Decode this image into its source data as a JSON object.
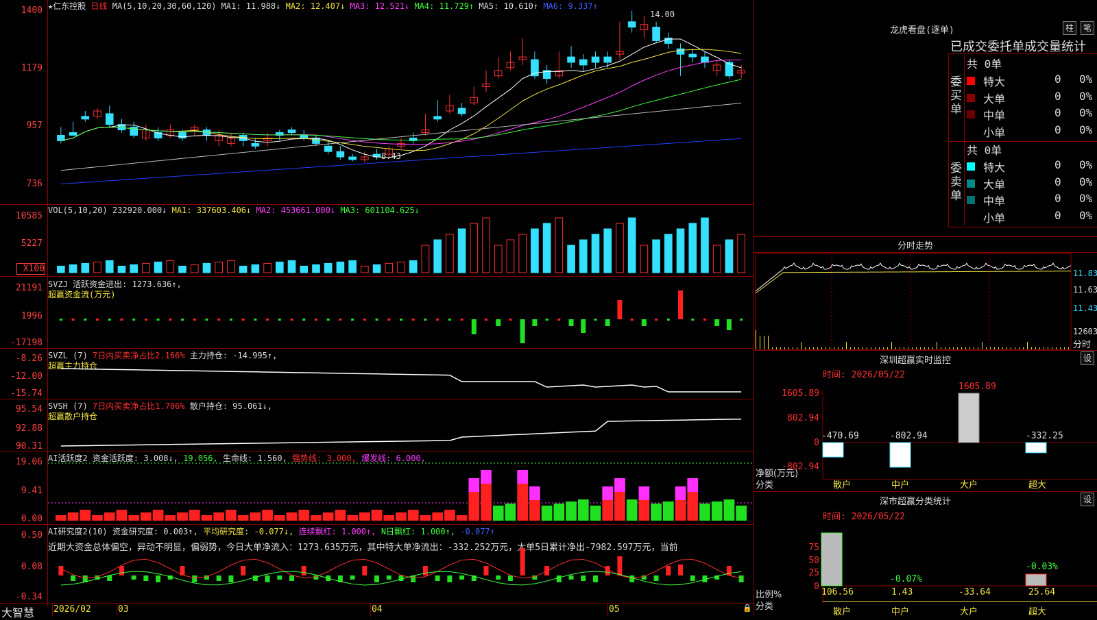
{
  "header": {
    "stock_name": "★仁东控股",
    "period": "日线",
    "ma_params": "MA(5,10,20,30,60,120)",
    "ma1": "MA1: 11.988↓",
    "ma2": "MA2: 12.407↓",
    "ma3": "MA3: 12.521↓",
    "ma4": "MA4: 11.729↑",
    "ma5": "MA5: 10.610↑",
    "ma6": "MA6: 9.337↑"
  },
  "price_axis": [
    "1400",
    "1179",
    "957",
    "736"
  ],
  "price_marks": {
    "high": "14.00",
    "low": "8.43"
  },
  "vol": {
    "params": "VOL(5,10,20)",
    "v": "232920.000↓",
    "ma1": "MA1: 337603.406↓",
    "ma2": "MA2: 453661.000↓",
    "ma3": "MA3: 601104.625↓",
    "axis": [
      "10585",
      "5227",
      "X100"
    ]
  },
  "svzj": {
    "name": "SVZJ",
    "line1": "活跃资金进出: 1273.636↑,",
    "line2": "超赢资金流(万元)",
    "axis": [
      "21191",
      "1996",
      "-17198"
    ]
  },
  "svzl": {
    "name": "SVZL (7)",
    "ratio": "7日内买卖净占比2.166%",
    "hold": "主力持仓: -14.995↑,",
    "line2": "超赢主力持仓",
    "axis": [
      "-8.26",
      "-12.00",
      "-15.74"
    ]
  },
  "svsh": {
    "name": "SVSH (7)",
    "ratio": "7日内买卖净占比1.706%",
    "hold": "散户持仓: 95.061↓,",
    "line2": "超赢散户持仓",
    "axis": [
      "95.54",
      "92.88",
      "90.31"
    ]
  },
  "ai1": {
    "name": "AI活跃度2",
    "a": "资金活跃度: 3.008↓,",
    "b": "19.056,",
    "c": "生命线: 1.560,",
    "d": "强势线: 3.000,",
    "e": "爆发线: 6.000,",
    "axis": [
      "19.06",
      "9.41",
      "0.00"
    ]
  },
  "ai2": {
    "name": "AI研究度2(10)",
    "a": "资金研究度: 0.003↑,",
    "b": "平均研究度: -0.077↓,",
    "c": "连续飘红: 1.000↑,",
    "d": "N日飘红: 1.000↑,",
    "e": "-0.077↑",
    "comment": "近期大资金总体偏空，异动不明显，偏弱势，今日大单净流入：1273.635万元，其中特大单净流出：-332.252万元，大单5日累计净出-7982.597万元，当前",
    "axis": [
      "0.50",
      "0.08",
      "-0.34"
    ]
  },
  "bottom": {
    "logo": "大智慧",
    "dates": [
      "2026/02",
      "03",
      "04",
      "05"
    ]
  },
  "right": {
    "lhb_title": "龙虎看盘(逐单)",
    "btn_zhu": "柱",
    "btn_bi": "笔",
    "tabs": "已成交委托单成交量统计",
    "buy_label": "委买单",
    "sell_label": "委卖单",
    "buy_total": "共 0单",
    "sell_total": "共 0单",
    "rows": [
      "特大",
      "大单",
      "中单",
      "小单"
    ],
    "zero": "0",
    "pct": "0%",
    "fs_title": "分时走势",
    "fs_axis": [
      "11.83",
      "11.63",
      "11.43",
      "12603"
    ],
    "fs_unit": "分时",
    "monitor_title": "深圳超赢实时监控",
    "monitor_time": "时间: 2026/05/22",
    "monitor_btn": "设",
    "monitor_axis": [
      "1605.89",
      "802.94",
      "0",
      "-802.94"
    ],
    "monitor_values": [
      "-470.69",
      "-802.94",
      "1605.89",
      "-332.25"
    ],
    "monitor_ylabel": "净额(万元)",
    "monitor_xlabel": "分类",
    "categories": [
      "散户",
      "中户",
      "大户",
      "超大"
    ],
    "stat_title": "深市超赢分类统计",
    "stat_time": "时间: 2026/05/22",
    "stat_btn": "设",
    "stat_axis": [
      "75",
      "50",
      "25",
      "0"
    ],
    "stat_top": [
      "-0.07%",
      "-0.03%"
    ],
    "stat_values": [
      "106.56",
      "1.43",
      "-33.64",
      "25.64"
    ],
    "stat_ylabel": "比例%",
    "stat_xlabel": "分类"
  },
  "chart_data": [
    {
      "type": "candlestick",
      "title": "★仁东控股 日线",
      "ylim": [
        7.36,
        14.0
      ],
      "series": [
        {
          "name": "MA1",
          "color": "#ffffff"
        },
        {
          "name": "MA2",
          "color": "#f4e542"
        },
        {
          "name": "MA3",
          "color": "#ff40ff"
        },
        {
          "name": "MA4",
          "color": "#40ff40"
        },
        {
          "name": "MA5",
          "color": "#bbbbbb"
        },
        {
          "name": "MA6",
          "color": "#2040ff"
        }
      ],
      "candles": [
        [
          9.4,
          9.7,
          9.2,
          9.1,
          0
        ],
        [
          9.5,
          9.9,
          9.4,
          9.5,
          0
        ],
        [
          10.1,
          10.3,
          10.0,
          9.9,
          0
        ],
        [
          10.3,
          10.4,
          10.1,
          10.0,
          1
        ],
        [
          10.2,
          10.5,
          9.8,
          9.7,
          0
        ],
        [
          9.8,
          10.0,
          9.6,
          9.5,
          0
        ],
        [
          9.7,
          9.9,
          9.4,
          9.3,
          0
        ],
        [
          9.6,
          9.8,
          9.3,
          9.2,
          1
        ],
        [
          9.5,
          9.7,
          9.3,
          9.2,
          0
        ],
        [
          9.6,
          9.8,
          9.4,
          9.3,
          1
        ],
        [
          9.5,
          9.6,
          9.3,
          9.2,
          0
        ],
        [
          9.7,
          9.8,
          9.6,
          9.4,
          1
        ],
        [
          9.6,
          9.7,
          9.4,
          9.2,
          0
        ],
        [
          9.4,
          9.6,
          9.2,
          9.0,
          1
        ],
        [
          9.3,
          9.5,
          9.1,
          9.0,
          1
        ],
        [
          9.4,
          9.5,
          9.2,
          9.0,
          0
        ],
        [
          9.1,
          9.3,
          9.0,
          8.9,
          0
        ],
        [
          9.3,
          9.5,
          9.2,
          9.0,
          1
        ],
        [
          9.5,
          9.6,
          9.4,
          9.2,
          0
        ],
        [
          9.6,
          9.7,
          9.5,
          9.4,
          0
        ],
        [
          9.4,
          9.6,
          9.3,
          9.2,
          0
        ],
        [
          9.3,
          9.4,
          9.1,
          9.0,
          0
        ],
        [
          9.0,
          9.2,
          8.8,
          8.7,
          0
        ],
        [
          8.8,
          9.0,
          8.6,
          8.5,
          0
        ],
        [
          8.6,
          8.7,
          8.5,
          8.43,
          0
        ],
        [
          8.6,
          8.8,
          8.5,
          8.4,
          1
        ],
        [
          8.7,
          8.9,
          8.6,
          8.5,
          0
        ],
        [
          8.9,
          9.0,
          8.7,
          8.6,
          1
        ],
        [
          9.1,
          9.3,
          9.0,
          8.9,
          1
        ],
        [
          9.3,
          9.5,
          9.2,
          9.1,
          0
        ],
        [
          9.6,
          10.2,
          9.5,
          9.4,
          1
        ],
        [
          10.1,
          10.7,
          10.0,
          9.9,
          0
        ],
        [
          10.5,
          10.9,
          10.3,
          10.2,
          1
        ],
        [
          10.4,
          10.6,
          10.2,
          10.1,
          0
        ],
        [
          10.8,
          11.2,
          10.6,
          10.5,
          1
        ],
        [
          11.3,
          11.8,
          11.2,
          11.0,
          1
        ],
        [
          11.8,
          12.3,
          11.6,
          11.5,
          1
        ],
        [
          12.1,
          12.5,
          11.9,
          11.8,
          1
        ],
        [
          12.3,
          13.0,
          12.2,
          12.0,
          1
        ],
        [
          12.2,
          12.5,
          11.6,
          11.5,
          0
        ],
        [
          11.8,
          12.0,
          11.5,
          11.3,
          0
        ],
        [
          11.8,
          12.5,
          11.6,
          11.5,
          1
        ],
        [
          12.3,
          12.7,
          12.1,
          11.9,
          0
        ],
        [
          12.2,
          12.4,
          12.0,
          11.8,
          0
        ],
        [
          12.3,
          12.5,
          12.1,
          11.9,
          0
        ],
        [
          12.3,
          12.5,
          12.1,
          11.9,
          0
        ],
        [
          12.5,
          13.6,
          12.4,
          12.2,
          1
        ],
        [
          13.6,
          14.0,
          13.4,
          13.2,
          0
        ],
        [
          13.5,
          13.8,
          13.3,
          13.0,
          1
        ],
        [
          13.4,
          13.6,
          12.9,
          12.8,
          0
        ],
        [
          13.0,
          13.2,
          12.8,
          12.6,
          0
        ],
        [
          12.6,
          12.8,
          12.4,
          11.6,
          0
        ],
        [
          12.4,
          12.6,
          12.3,
          12.1,
          0
        ],
        [
          12.3,
          12.5,
          12.1,
          11.9,
          0
        ],
        [
          12.0,
          12.2,
          11.8,
          11.6,
          1
        ],
        [
          12.1,
          12.2,
          11.6,
          11.5,
          0
        ],
        [
          11.8,
          12.0,
          11.7,
          11.5,
          1
        ]
      ]
    }
  ]
}
